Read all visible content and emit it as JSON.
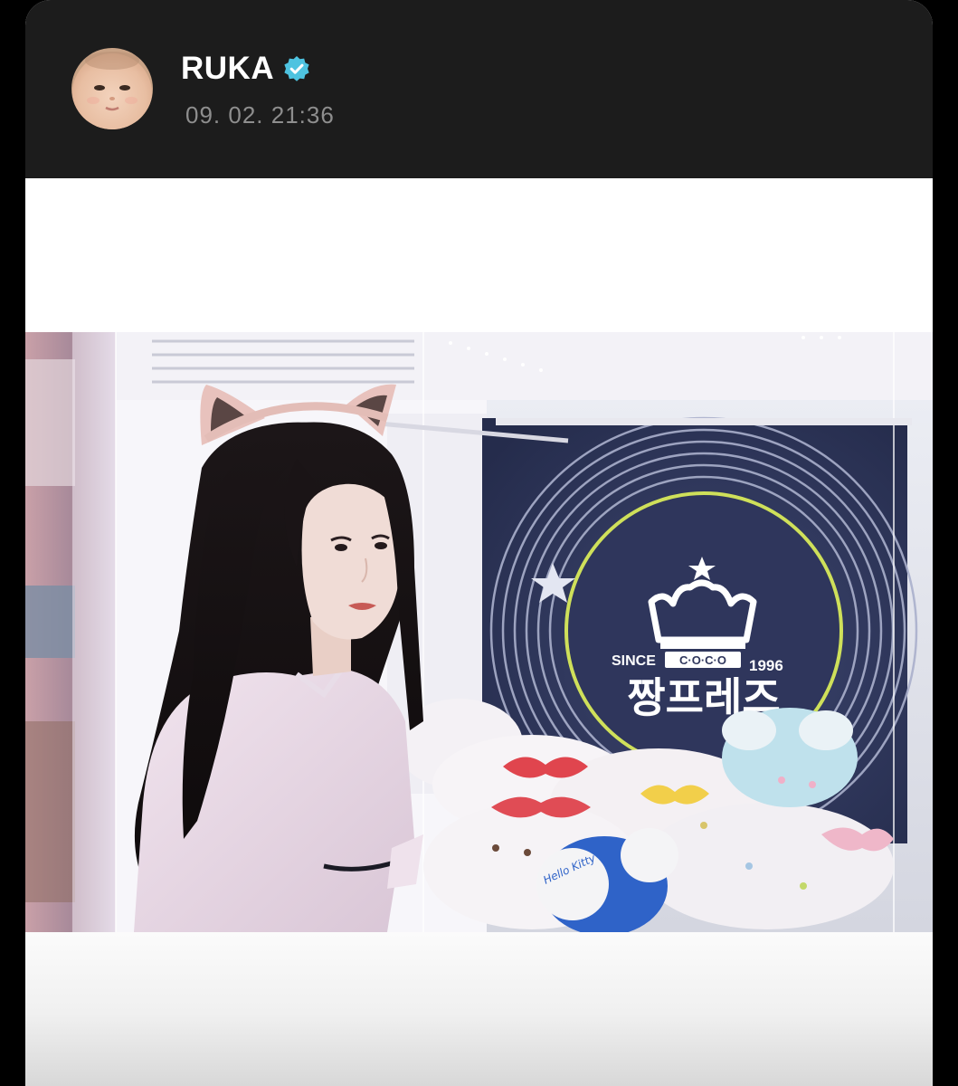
{
  "post": {
    "username": "RUKA",
    "timestamp": "09. 02. 21:36",
    "verified": true,
    "avatar": "baby-face-avatar"
  },
  "photo": {
    "sign": {
      "since_left": "SINCE",
      "brand_small": "C·O·C·O",
      "since_right": "1996",
      "brand_main": "짱프레즈"
    },
    "plush_tag": "Hello Kitty"
  },
  "colors": {
    "header_bg": "#1c1c1c",
    "username": "#ffffff",
    "timestamp": "#8e8e8e",
    "verified_badge": "#4ec3e0",
    "content_bg": "#ffffff"
  },
  "icons": {
    "verified": "verified-badge-icon"
  }
}
